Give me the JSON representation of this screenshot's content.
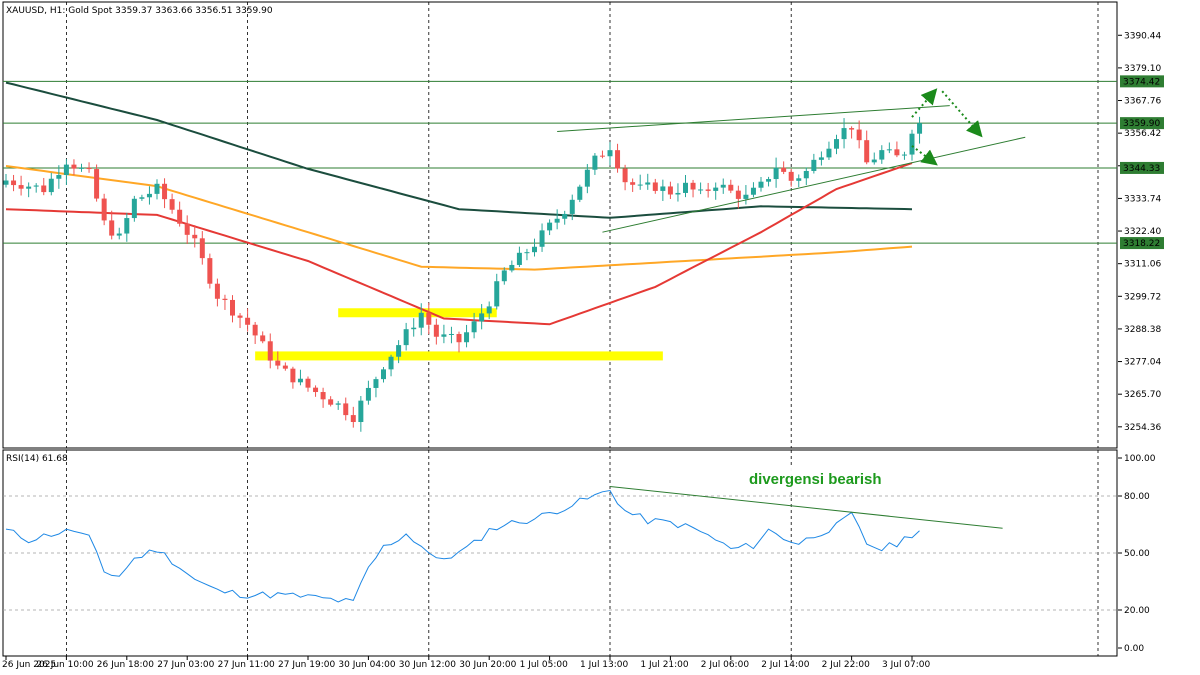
{
  "header": {
    "title": "XAUUSD, H1:  Gold Spot  3359.37 3363.66 3356.51 3359.90"
  },
  "rsi_panel": {
    "label": "RSI(14) 61.68"
  },
  "annotation": {
    "text": "divergensi bearish"
  },
  "colors": {
    "bull": "#26a69a",
    "bear": "#ef5350",
    "ma_red": "#e53935",
    "ma_orange": "#ffa726",
    "ma_dark": "#1b4d3e",
    "rsi_line": "#1e88e5",
    "level_line": "#2e7d32",
    "zone": "#ffff00",
    "price_tag": "#2e7d32",
    "arrow": "#1b8a1b"
  },
  "chart_data": [
    {
      "type": "candlestick",
      "title": "XAUUSD, H1: Gold Spot",
      "ohlc_last": {
        "open": 3359.37,
        "high": 3363.66,
        "low": 3356.51,
        "close": 3359.9
      },
      "y_ticks": [
        3390.44,
        3379.1,
        3367.76,
        3356.42,
        3345.08,
        3333.74,
        3322.4,
        3311.06,
        3299.72,
        3288.38,
        3277.04,
        3265.7,
        3254.36
      ],
      "ylim": [
        3247.0,
        3402.0
      ],
      "x_ticks": [
        "26 Jun 2025",
        "26 Jun 10:00",
        "26 Jun 18:00",
        "27 Jun 03:00",
        "27 Jun 11:00",
        "27 Jun 19:00",
        "30 Jun 04:00",
        "30 Jun 12:00",
        "30 Jun 20:00",
        "1 Jul 05:00",
        "1 Jul 13:00",
        "1 Jul 21:00",
        "2 Jul 06:00",
        "2 Jul 14:00",
        "2 Jul 22:00",
        "3 Jul 07:00"
      ],
      "x_tick_index": [
        0,
        8,
        16,
        24,
        32,
        40,
        48,
        56,
        64,
        72,
        80,
        88,
        96,
        104,
        112,
        120
      ],
      "close_path": [
        [
          0,
          3340
        ],
        [
          5,
          3337
        ],
        [
          8,
          3347
        ],
        [
          11,
          3342
        ],
        [
          13,
          3325
        ],
        [
          15,
          3320
        ],
        [
          17,
          3333
        ],
        [
          20,
          3337
        ],
        [
          22,
          3330
        ],
        [
          25,
          3318
        ],
        [
          28,
          3300
        ],
        [
          32,
          3290
        ],
        [
          36,
          3275
        ],
        [
          40,
          3268
        ],
        [
          44,
          3262
        ],
        [
          46,
          3258
        ],
        [
          50,
          3276
        ],
        [
          52,
          3283
        ],
        [
          55,
          3294
        ],
        [
          57,
          3286
        ],
        [
          60,
          3284
        ],
        [
          62,
          3290
        ],
        [
          64,
          3298
        ],
        [
          66,
          3308
        ],
        [
          70,
          3318
        ],
        [
          74,
          3330
        ],
        [
          78,
          3347
        ],
        [
          80,
          3352
        ],
        [
          82,
          3340
        ],
        [
          84,
          3337
        ],
        [
          86,
          3338
        ],
        [
          88,
          3336
        ],
        [
          90,
          3338
        ],
        [
          92,
          3335
        ],
        [
          94,
          3339
        ],
        [
          96,
          3336
        ],
        [
          98,
          3334
        ],
        [
          100,
          3338
        ],
        [
          102,
          3345
        ],
        [
          104,
          3340
        ],
        [
          106,
          3343
        ],
        [
          108,
          3350
        ],
        [
          110,
          3356
        ],
        [
          112,
          3359
        ],
        [
          113,
          3352
        ],
        [
          114,
          3346
        ],
        [
          116,
          3350
        ],
        [
          118,
          3348
        ],
        [
          119,
          3350
        ],
        [
          120,
          3358
        ],
        [
          121,
          3359.9
        ]
      ],
      "horizontal_levels": [
        {
          "price": 3374.42,
          "tag": "3374.42"
        },
        {
          "price": 3359.9,
          "tag": "3359.90"
        },
        {
          "price": 3344.33,
          "tag": "3344.33"
        },
        {
          "price": 3318.22,
          "tag": "3318.22"
        }
      ],
      "moving_averages": [
        {
          "color_key": "ma_dark",
          "points": [
            [
              0,
              3374
            ],
            [
              20,
              3361
            ],
            [
              40,
              3344
            ],
            [
              60,
              3330
            ],
            [
              80,
              3327
            ],
            [
              100,
              3331
            ],
            [
              120,
              3330
            ]
          ]
        },
        {
          "color_key": "ma_orange",
          "points": [
            [
              0,
              3345
            ],
            [
              20,
              3338
            ],
            [
              40,
              3322
            ],
            [
              55,
              3310
            ],
            [
              70,
              3309
            ],
            [
              90,
              3312
            ],
            [
              110,
              3315
            ],
            [
              120,
              3317
            ]
          ]
        },
        {
          "color_key": "ma_red",
          "points": [
            [
              0,
              3330
            ],
            [
              20,
              3328
            ],
            [
              40,
              3312
            ],
            [
              58,
              3292
            ],
            [
              72,
              3290
            ],
            [
              86,
              3303
            ],
            [
              100,
              3322
            ],
            [
              110,
              3337
            ],
            [
              120,
              3346
            ]
          ]
        }
      ],
      "zones": [
        {
          "x_from": 44,
          "x_to": 65,
          "price": 3294
        },
        {
          "x_from": 33,
          "x_to": 87,
          "price": 3279
        }
      ],
      "trend_lines": [
        {
          "from": [
            73,
            3357
          ],
          "to": [
            125,
            3366
          ]
        },
        {
          "from": [
            79,
            3322
          ],
          "to": [
            135,
            3355
          ]
        }
      ],
      "arrows": [
        {
          "from": [
            120,
            3362
          ],
          "to": [
            123,
            3371
          ]
        },
        {
          "from": [
            124,
            3371
          ],
          "to": [
            129,
            3356
          ]
        },
        {
          "from": [
            120,
            3352
          ],
          "to": [
            123,
            3346
          ]
        }
      ]
    },
    {
      "type": "line",
      "title": "RSI(14) 61.68",
      "y_ticks": [
        100.0,
        80.0,
        50.0,
        20.0,
        0.0
      ],
      "ylim": [
        0,
        100
      ],
      "gridlines": [
        80,
        50,
        20
      ],
      "series": [
        {
          "name": "RSI(14)",
          "points": [
            [
              0,
              62
            ],
            [
              3,
              57
            ],
            [
              6,
              60
            ],
            [
              9,
              62
            ],
            [
              11,
              58
            ],
            [
              13,
              40
            ],
            [
              15,
              38
            ],
            [
              17,
              47
            ],
            [
              20,
              52
            ],
            [
              22,
              46
            ],
            [
              25,
              36
            ],
            [
              28,
              30
            ],
            [
              32,
              28
            ],
            [
              36,
              28
            ],
            [
              40,
              27
            ],
            [
              44,
              25
            ],
            [
              46,
              24
            ],
            [
              48,
              42
            ],
            [
              50,
              53
            ],
            [
              53,
              60
            ],
            [
              55,
              54
            ],
            [
              57,
              46
            ],
            [
              60,
              50
            ],
            [
              62,
              55
            ],
            [
              64,
              62
            ],
            [
              66,
              65
            ],
            [
              70,
              68
            ],
            [
              74,
              74
            ],
            [
              78,
              80
            ],
            [
              80,
              83
            ],
            [
              82,
              72
            ],
            [
              85,
              67
            ],
            [
              88,
              66
            ],
            [
              91,
              63
            ],
            [
              94,
              57
            ],
            [
              96,
              52
            ],
            [
              99,
              54
            ],
            [
              101,
              62
            ],
            [
              103,
              58
            ],
            [
              105,
              55
            ],
            [
              108,
              61
            ],
            [
              110,
              64
            ],
            [
              112,
              70
            ],
            [
              114,
              55
            ],
            [
              116,
              52
            ],
            [
              118,
              55
            ],
            [
              120,
              60
            ],
            [
              121,
              61.68
            ]
          ]
        }
      ],
      "trend_line": {
        "from": [
          80,
          85
        ],
        "to": [
          132,
          63
        ]
      }
    }
  ]
}
